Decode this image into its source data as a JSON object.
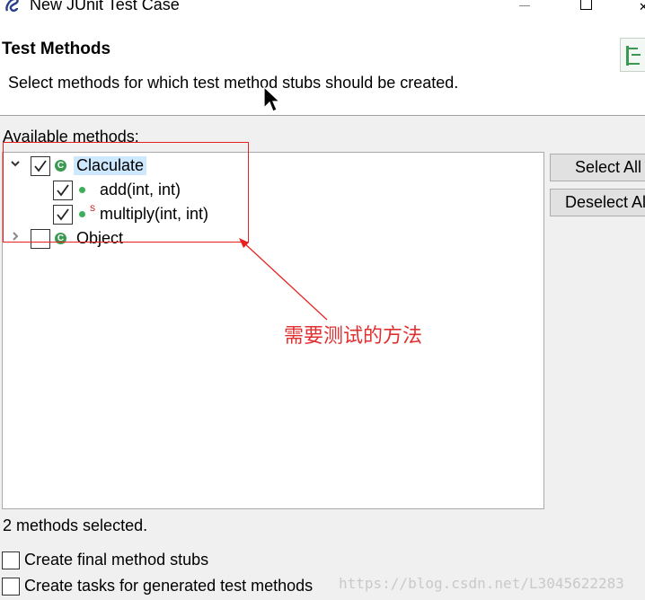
{
  "window": {
    "title": "New JUnit Test Case"
  },
  "header": {
    "title": "Test Methods",
    "description": "Select methods for which test method stubs should be created."
  },
  "methods_panel": {
    "label": "Available methods:",
    "tree": [
      {
        "label": "Claculate",
        "checked": true,
        "expanded": true,
        "selected": true,
        "children": [
          {
            "label": "add(int, int)",
            "checked": true
          },
          {
            "label": "multiply(int, int)",
            "checked": true,
            "static_marker": "S"
          }
        ]
      },
      {
        "label": "Object",
        "checked": false,
        "expanded": false
      }
    ],
    "buttons": {
      "select_all": "Select All",
      "deselect_all": "Deselect All"
    }
  },
  "status": "2 methods selected.",
  "options": {
    "final_stubs": {
      "label": "Create final method stubs",
      "checked": false
    },
    "tasks": {
      "label": "Create tasks for generated test methods",
      "checked": false
    }
  },
  "annotation": {
    "text": "需要测试的方法",
    "color": "#e82020"
  },
  "watermark": "https://blog.csdn.net/L3045622283",
  "colors": {
    "selection": "#cde8ff",
    "class_icon": "#3a9a52",
    "method_icon": "#3fae5a"
  }
}
